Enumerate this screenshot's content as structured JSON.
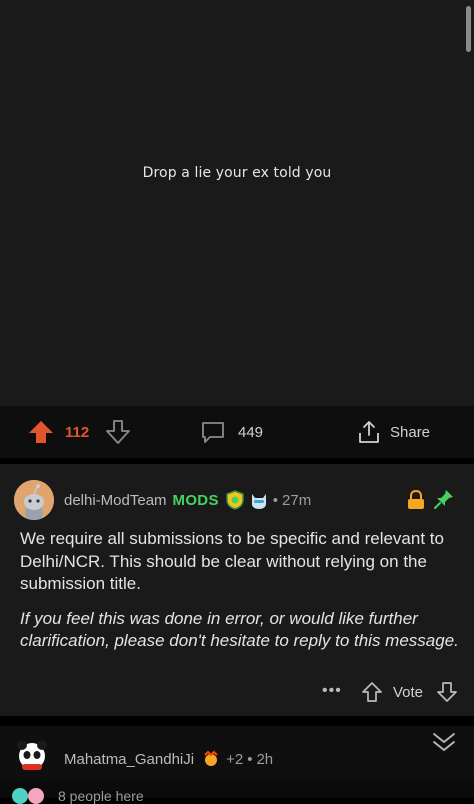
{
  "post": {
    "caption": "Drop a lie your ex told you",
    "upvotes": "112",
    "comments": "449",
    "share_label": "Share"
  },
  "mod_comment": {
    "author": "delhi-ModTeam",
    "badge": "MODS",
    "time": "27m",
    "paragraph1": "We require all submissions to be specific and relevant to Delhi/NCR. This should be clear without relying on the submission title.",
    "paragraph2": "If you feel this was done in error, or would like further clarification, please don't hesitate to reply to this message.",
    "vote_label": "Vote"
  },
  "next_comment": {
    "author": "Mahatma_GandhiJi",
    "awards": "+2",
    "time": "2h"
  },
  "presence": {
    "text": "8 people here"
  },
  "colors": {
    "upvote": "#e3552a",
    "mods": "#46d160",
    "lock": "#f5a623",
    "pin": "#46d160"
  }
}
